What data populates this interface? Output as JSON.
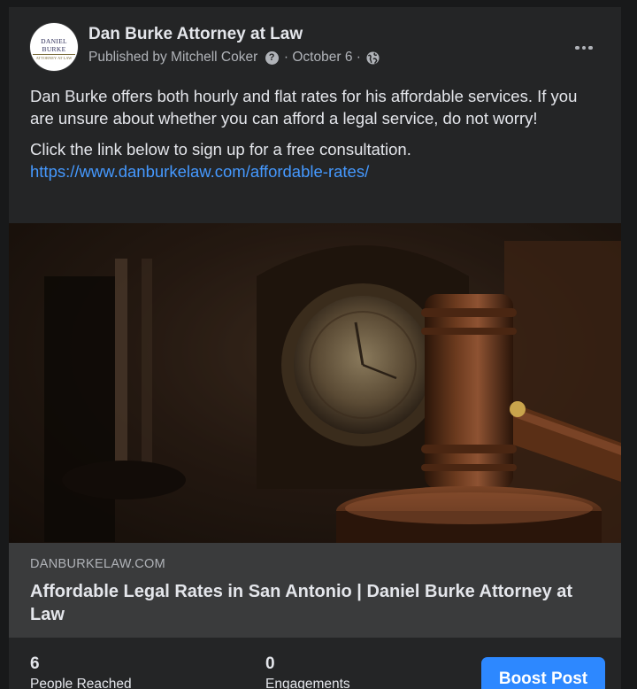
{
  "post": {
    "page_name": "Dan Burke Attorney at Law",
    "avatar": {
      "name": "Daniel Burke",
      "sub": "ATTORNEY AT LAW"
    },
    "published_by": "Published by Mitchell Coker",
    "info_icon": "question-circle-icon",
    "separator": "·",
    "date": "October 6",
    "privacy_icon": "globe-icon",
    "more_icon": "more-horizontal-icon",
    "paragraph_1": "Dan Burke offers both hourly and flat rates for his affordable services. If you are unsure about whether you can afford a legal service, do not worry!",
    "paragraph_2": "Click the link below to sign up for a free consultation.",
    "link_url": "https://www.danburkelaw.com/affordable-rates/"
  },
  "link_preview": {
    "domain": "DANBURKELAW.COM",
    "title": "Affordable Legal Rates in San Antonio | Daniel Burke Attorney at Law"
  },
  "stats": {
    "reached_count": "6",
    "reached_label": "People Reached",
    "engagements_count": "0",
    "engagements_label": "Engagements",
    "boost_label": "Boost Post"
  },
  "colors": {
    "background": "#18191a",
    "card": "#242526",
    "preview": "#3a3b3c",
    "link": "#4599ff",
    "boost": "#2d88ff"
  }
}
